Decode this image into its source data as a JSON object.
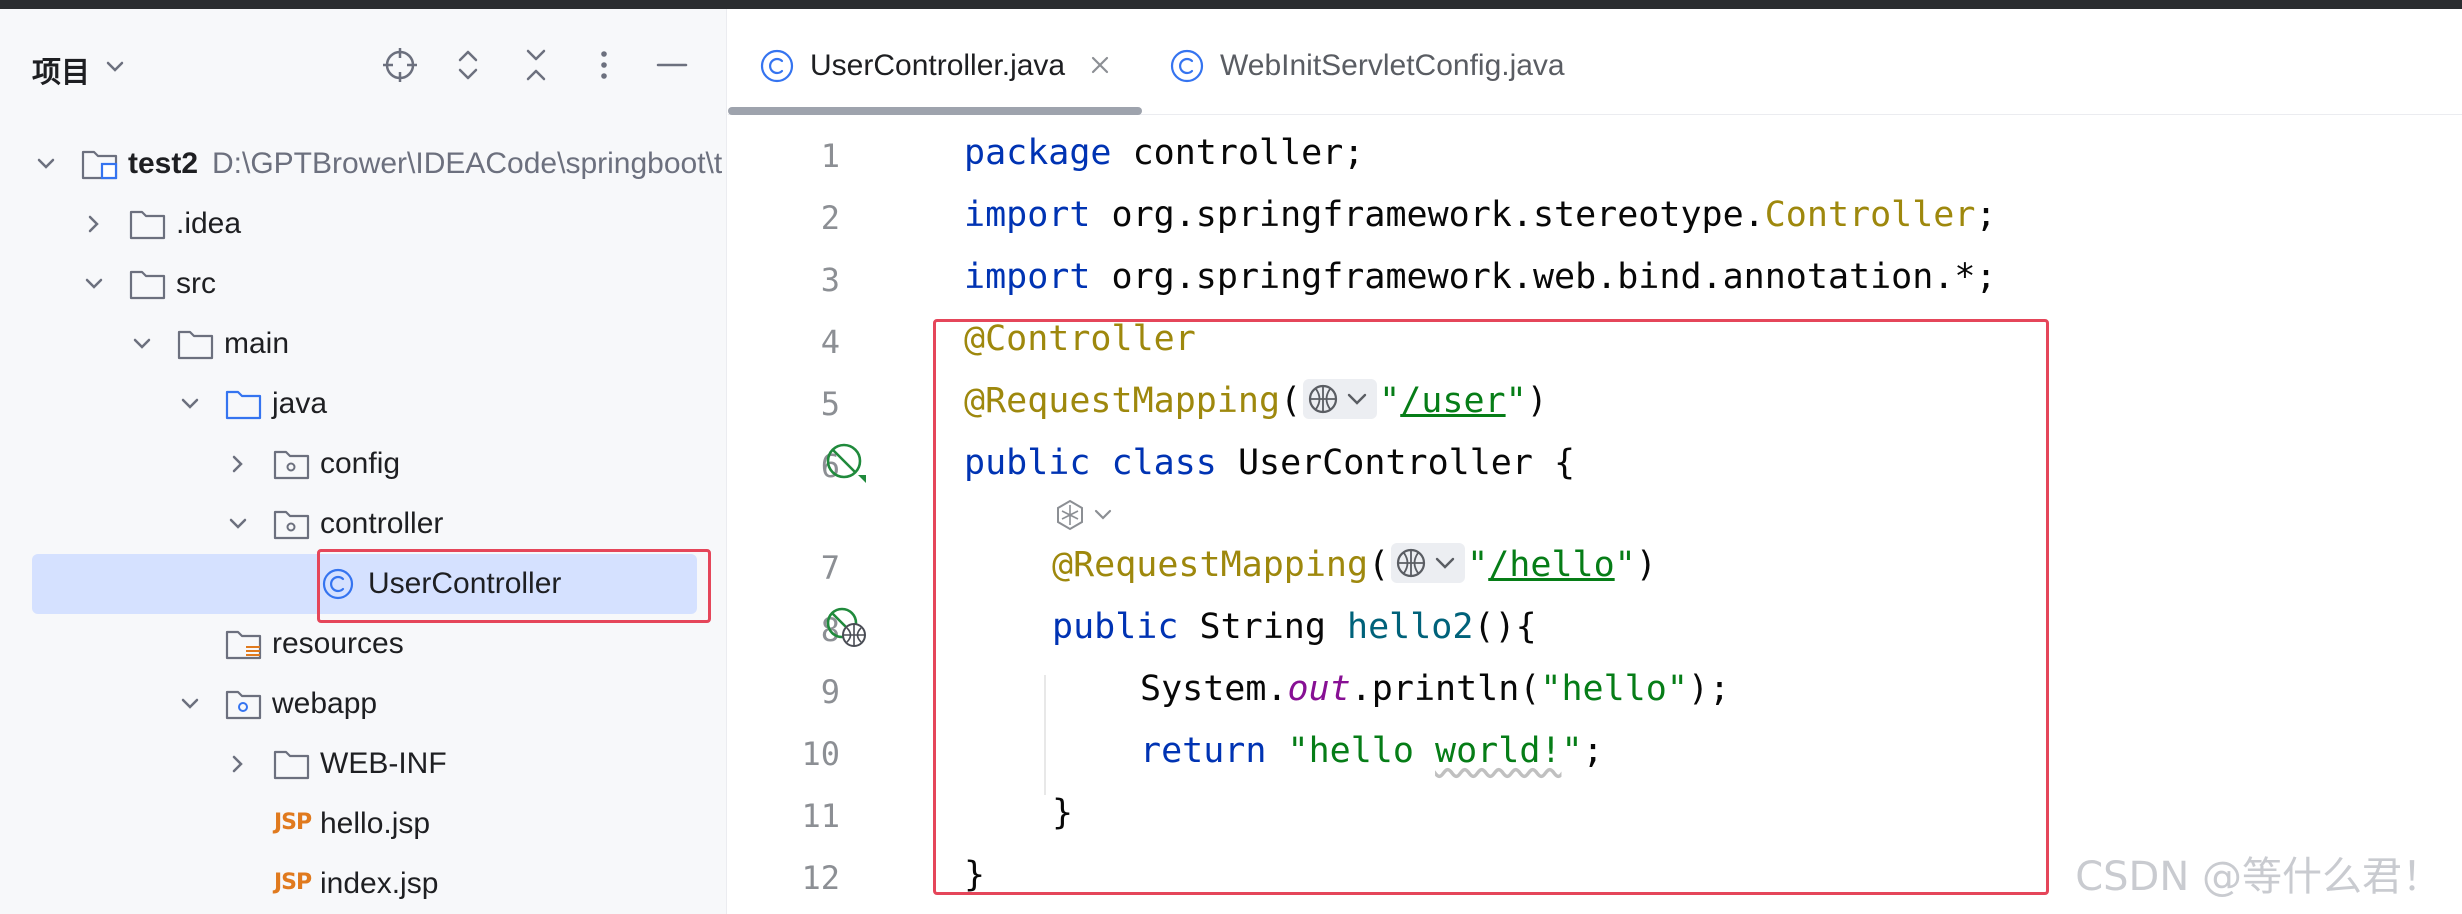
{
  "project_panel": {
    "title": "项目",
    "tree": [
      {
        "label": "test2",
        "path": "D:\\GPTBrower\\IDEACode\\springboot\\t"
      },
      {
        "label": ".idea"
      },
      {
        "label": "src"
      },
      {
        "label": "main"
      },
      {
        "label": "java"
      },
      {
        "label": "config"
      },
      {
        "label": "controller"
      },
      {
        "label": "UserController"
      },
      {
        "label": "resources"
      },
      {
        "label": "webapp"
      },
      {
        "label": "WEB-INF"
      },
      {
        "label": "hello.jsp",
        "badge": "JSP"
      },
      {
        "label": "index.jsp",
        "badge": "JSP"
      }
    ]
  },
  "editor": {
    "tabs": [
      {
        "label": "UserController.java"
      },
      {
        "label": "WebInitServletConfig.java"
      }
    ],
    "line_numbers": [
      "1",
      "2",
      "3",
      "4",
      "5",
      "6",
      "7",
      "8",
      "9",
      "10",
      "11",
      "12"
    ],
    "code": {
      "l1_kw": "package",
      "l1_rest": " controller;",
      "l2_kw": "import",
      "l2_rest": " org.springframework.stereotype.",
      "l2_cls": "Controller",
      "l2_end": ";",
      "l3_kw": "import",
      "l3_rest": " org.springframework.web.bind.annotation.*;",
      "l4_ann": "@Controller",
      "l5_ann": "@RequestMapping",
      "l5_open": "(",
      "l5_q1": "\"",
      "l5_url": "/user",
      "l5_q2": "\"",
      "l5_close": ")",
      "l6_kw": "public class",
      "l6_rest": " UserController {",
      "l7_ann": "@RequestMapping",
      "l7_open": "(",
      "l7_q1": "\"",
      "l7_url": "/hello",
      "l7_q2": "\"",
      "l7_close": ")",
      "l8_kw": "public",
      "l8_type": " String ",
      "l8_mth": "hello2",
      "l8_rest": "(){",
      "l9_a": "System.",
      "l9_fld": "out",
      "l9_b": ".println(",
      "l9_str": "\"hello\"",
      "l9_c": ");",
      "l10_kw": "return",
      "l10_sp": " ",
      "l10_q1": "\"hello ",
      "l10_sq": "world!",
      "l10_q2": "\"",
      "l10_end": ";",
      "l11": "}",
      "l12": "}"
    }
  },
  "watermark": "CSDN @等什么君！"
}
